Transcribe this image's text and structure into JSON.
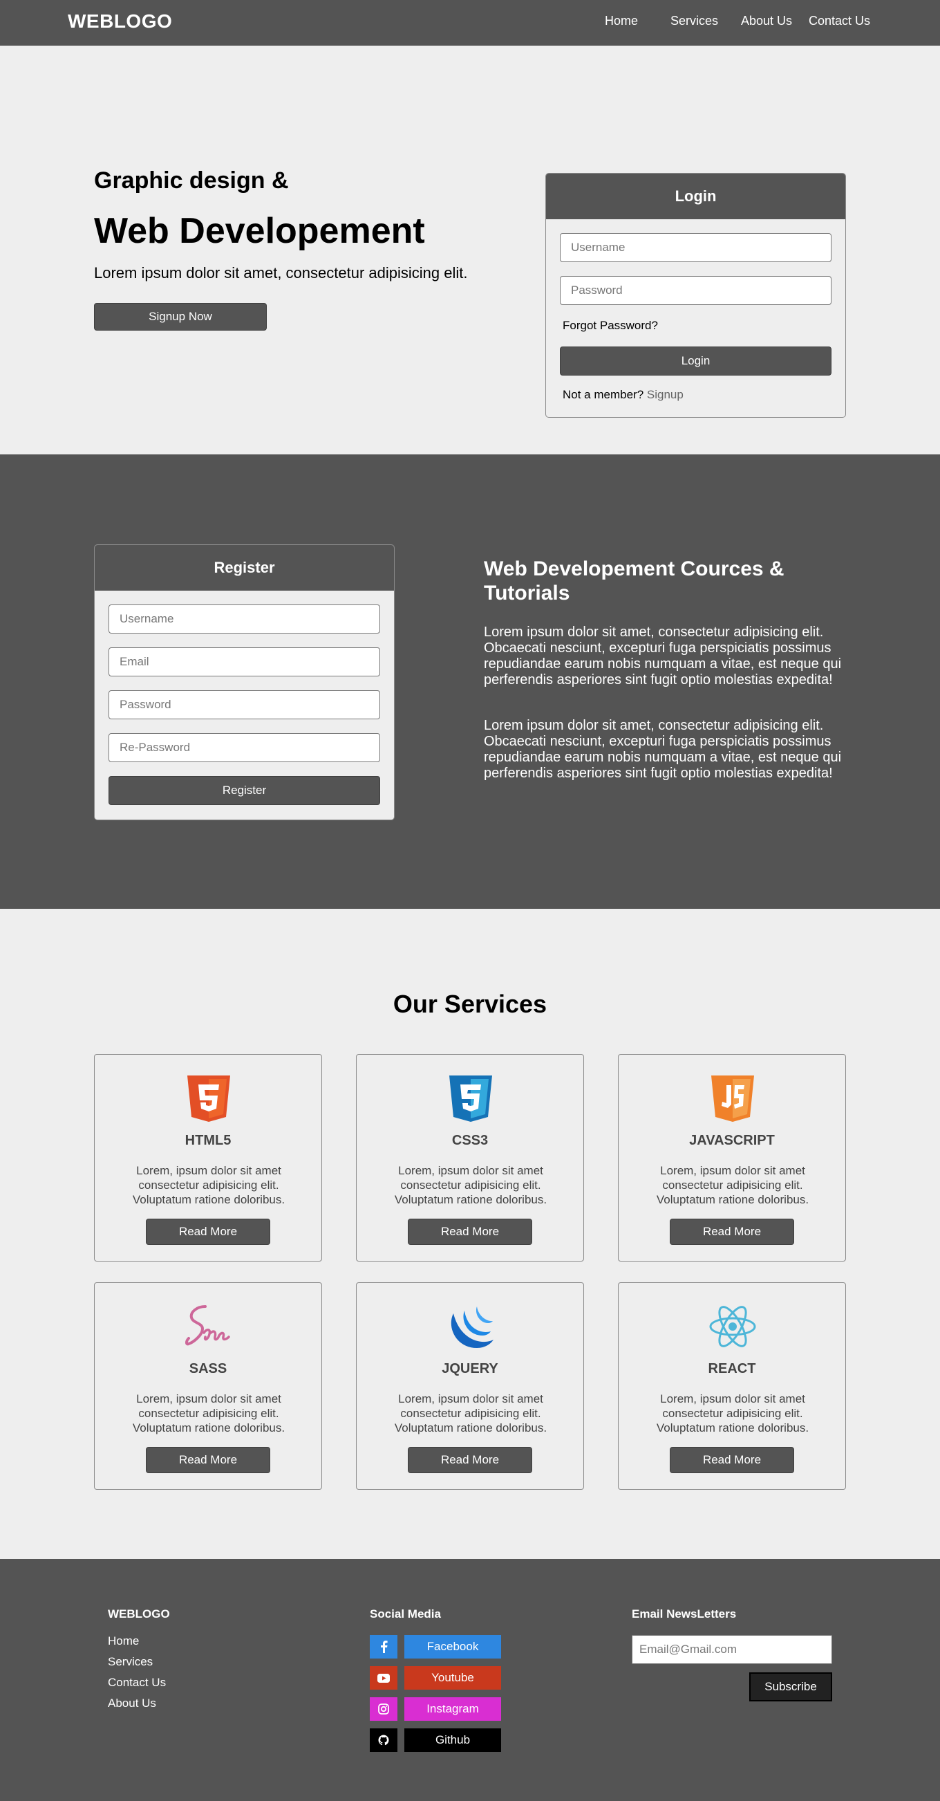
{
  "nav": {
    "logo": "WEBLOGO",
    "links": [
      "Home",
      "Services",
      "About Us",
      "Contact Us"
    ]
  },
  "hero": {
    "subtitle": "Graphic design &",
    "title": "Web Developement",
    "text": "Lorem ipsum dolor sit amet, consectetur adipisicing elit.",
    "signup_label": "Signup Now"
  },
  "login": {
    "title": "Login",
    "username_placeholder": "Username",
    "password_placeholder": "Password",
    "forgot": "Forgot Password?",
    "button": "Login",
    "member_text": "Not a member?",
    "signup_link": "Signup"
  },
  "register": {
    "title": "Register",
    "username_placeholder": "Username",
    "email_placeholder": "Email",
    "password_placeholder": "Password",
    "repassword_placeholder": "Re-Password",
    "button": "Register"
  },
  "courses": {
    "title": "Web Developement Cources & Tutorials",
    "p1": "Lorem ipsum dolor sit amet, consectetur adipisicing elit. Obcaecati nesciunt, excepturi fuga perspiciatis possimus repudiandae earum nobis numquam a vitae, est neque qui perferendis asperiores sint fugit optio molestias expedita!",
    "p2": "Lorem ipsum dolor sit amet, consectetur adipisicing elit. Obcaecati nesciunt, excepturi fuga perspiciatis possimus repudiandae earum nobis numquam a vitae, est neque qui perferendis asperiores sint fugit optio molestias expedita!"
  },
  "services": {
    "title": "Our Services",
    "items": [
      {
        "name": "HTML5",
        "icon": "html5-icon",
        "color": "#e34f26",
        "text": "Lorem, ipsum dolor sit amet consectetur adipisicing elit. Voluptatum ratione doloribus.",
        "button": "Read More"
      },
      {
        "name": "CSS3",
        "icon": "css3-icon",
        "color": "#1572b6",
        "text": "Lorem, ipsum dolor sit amet consectetur adipisicing elit. Voluptatum ratione doloribus.",
        "button": "Read More"
      },
      {
        "name": "JAVASCRIPT",
        "icon": "javascript-icon",
        "color": "#f0812a",
        "text": "Lorem, ipsum dolor sit amet consectetur adipisicing elit. Voluptatum ratione doloribus.",
        "button": "Read More"
      },
      {
        "name": "SASS",
        "icon": "sass-icon",
        "color": "#cd6799",
        "text": "Lorem, ipsum dolor sit amet consectetur adipisicing elit. Voluptatum ratione doloribus.",
        "button": "Read More"
      },
      {
        "name": "JQUERY",
        "icon": "jquery-icon",
        "color": "#1565c0",
        "text": "Lorem, ipsum dolor sit amet consectetur adipisicing elit. Voluptatum ratione doloribus.",
        "button": "Read More"
      },
      {
        "name": "REACT",
        "icon": "react-icon",
        "color": "#4db6d8",
        "text": "Lorem, ipsum dolor sit amet consectetur adipisicing elit. Voluptatum ratione doloribus.",
        "button": "Read More"
      }
    ]
  },
  "footer": {
    "logo": "WEBLOGO",
    "links": [
      "Home",
      "Services",
      "Contact Us",
      "About Us"
    ],
    "social_title": "Social Media",
    "social": [
      {
        "label": "Facebook",
        "icon": "facebook-icon",
        "color": "#2e87e0"
      },
      {
        "label": "Youtube",
        "icon": "youtube-icon",
        "color": "#c9391d"
      },
      {
        "label": "Instagram",
        "icon": "instagram-icon",
        "color": "#d92ed2"
      },
      {
        "label": "Github",
        "icon": "github-icon",
        "color": "#000000"
      }
    ],
    "newsletter_title": "Email NewsLetters",
    "email_placeholder": "Email@Gmail.com",
    "subscribe": "Subscribe"
  }
}
